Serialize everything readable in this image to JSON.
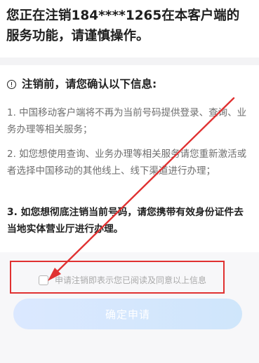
{
  "header": {
    "title": "您正在注销184****1265在本客户端的服务功能，请谨慎操作。"
  },
  "notice": {
    "heading": "注销前，请您确认以下信息:",
    "items": [
      "1. 中国移动客户端将不再为当前号码提供登录、查询、业务办理等相关服务；",
      "2. 如您想使用查询、业务办理等相关服务请您重新激活或者选择中国移动的其他线上、线下渠道进行办理；",
      "3. 如您想彻底注销当前号码，请您携带有效身份证件去当地实体营业厅进行办理。"
    ]
  },
  "agreement": {
    "label": "申请注销即表示您已阅读及同意以上信息",
    "checked": false
  },
  "actions": {
    "confirm_label": "确定申请"
  },
  "colors": {
    "annotation": "#e03131",
    "button_gradient_start": "#dbe8ff",
    "button_gradient_end": "#cfe6fb"
  }
}
